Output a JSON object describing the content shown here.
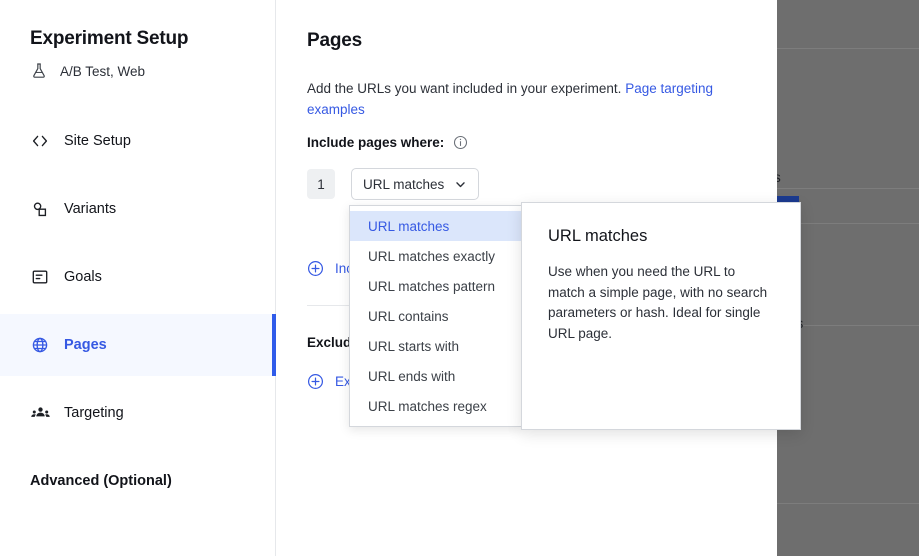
{
  "sidebar": {
    "title": "Experiment Setup",
    "subtitle": "A/B Test, Web",
    "subtitle_icon": "flask-icon",
    "items": [
      {
        "label": "Site Setup",
        "icon": "code-brackets-icon",
        "active": false
      },
      {
        "label": "Variants",
        "icon": "variants-icon",
        "active": false
      },
      {
        "label": "Goals",
        "icon": "goals-list-icon",
        "active": false
      },
      {
        "label": "Pages",
        "icon": "globe-icon",
        "active": true
      },
      {
        "label": "Targeting",
        "icon": "people-group-icon",
        "active": false
      },
      {
        "label": "Advanced (Optional)",
        "icon": "none",
        "active": false
      }
    ]
  },
  "main": {
    "title": "Pages",
    "description_text": "Add the URLs you want included in your experiment. ",
    "description_link": "Page targeting examples",
    "include_label": "Include pages where:",
    "info_icon": "info-circle-icon",
    "rule_number": "1",
    "selected_condition": "URL matches",
    "chevron_icon": "chevron-down-icon",
    "add_include_label": "Include another page",
    "add_exclude_label": "Exclude a page",
    "exclude_label": "Exclude pages where:",
    "plus_icon": "plus-circle-icon"
  },
  "dropdown": {
    "options": [
      "URL matches",
      "URL matches exactly",
      "URL matches pattern",
      "URL contains",
      "URL starts with",
      "URL ends with",
      "URL matches regex"
    ],
    "selected_index": 0
  },
  "tooltip": {
    "title": "URL matches",
    "body": "Use when you need the URL to match a simple page, with no search parameters or hash. Ideal for single URL page."
  },
  "right_dim": {
    "fragment_top": "s",
    "fragment_mid": "es"
  },
  "colors": {
    "accent_blue": "#3659e3",
    "active_bar": "#2f5bea",
    "active_bg": "#f5f8ff",
    "highlight_bg": "#dbe6fb",
    "dim_overlay": "#6e6e6e",
    "badge_bg": "#eef0f2",
    "border": "#d4d7dc"
  }
}
